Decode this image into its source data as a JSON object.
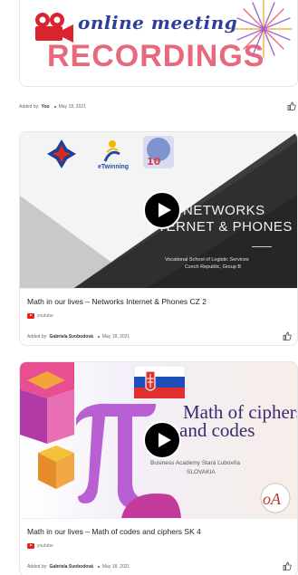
{
  "posts": [
    {
      "banner": {
        "line1": "online meeting",
        "line2": "RECORDINGS"
      },
      "meta": {
        "added_by_label": "Added by:",
        "author": "You",
        "date": "May 18, 2021"
      }
    },
    {
      "thumbnail": {
        "twinning_label": "eTwinning",
        "title_line1": "NETWORKS",
        "title_line2": "INTERNET & PHONES",
        "subtitle_line1": "Vocational School of Logistic Services",
        "subtitle_line2": "Czech Republic, Group B"
      },
      "title": "Math in our lives – Networks Internet & Phones CZ 2",
      "source": "youtube",
      "meta": {
        "added_by_label": "Added by:",
        "author": "Gabriela Svobodová",
        "date": "May 18, 2021"
      }
    },
    {
      "thumbnail": {
        "title_line1": "Math of ciphers",
        "title_line2": "and codes",
        "subtitle_line1": "Business Academy Stará Ľubovňa",
        "subtitle_line2": "SLOVAKIA"
      },
      "title": "Math in our lives – Math of codes and ciphers SK 4",
      "source": "youtube",
      "meta": {
        "added_by_label": "Added by:",
        "author": "Gabriela Svobodová",
        "date": "May 18, 2021"
      }
    }
  ],
  "colors": {
    "banner_blue": "#2d3f9a",
    "banner_pink": "#e9697c",
    "youtube_red": "#e62117",
    "camera_red": "#d9232e"
  },
  "icons": {
    "play": "play-icon",
    "like": "thumbs-up-icon",
    "source": "youtube-icon",
    "camera": "video-camera-icon"
  }
}
